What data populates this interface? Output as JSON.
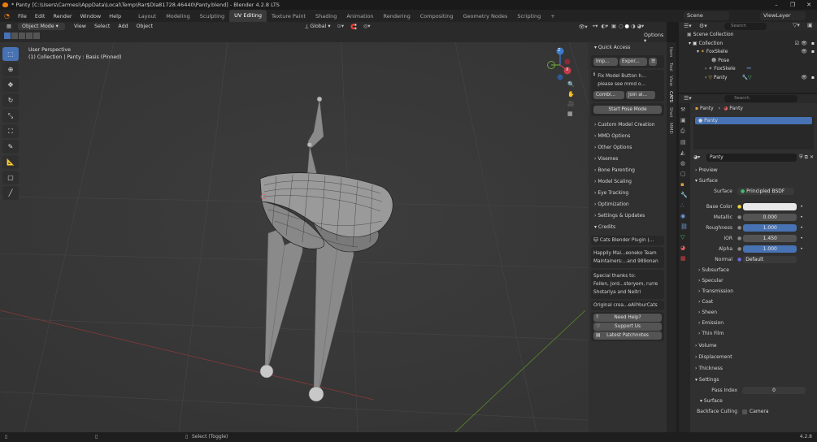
{
  "window": {
    "title": "* Panty [C:\\Users\\Carmesi\\AppData\\Local\\Temp\\Rar$DIa81728.46440\\Panty.blend] - Blender 4.2.8 LTS",
    "minimize": "–",
    "maximize": "❐",
    "close": "✕"
  },
  "menu": [
    "File",
    "Edit",
    "Render",
    "Window",
    "Help"
  ],
  "workspaces": [
    "Layout",
    "Modeling",
    "Sculpting",
    "UV Editing",
    "Texture Paint",
    "Shading",
    "Animation",
    "Rendering",
    "Compositing",
    "Geometry Nodes",
    "Scripting"
  ],
  "add_workspace": "+",
  "scene": "Scene",
  "viewlayer": "ViewLayer",
  "viewport_header": {
    "mode": "Object Mode",
    "menus": [
      "View",
      "Select",
      "Add",
      "Object"
    ],
    "orientation": "Global",
    "options": "Options"
  },
  "overlay_text": {
    "perspective": "User Perspective",
    "collection": "(1) Collection | Panty : Basis (Pinned)"
  },
  "gizmo": {
    "x": "X",
    "y": "Y",
    "z": "Z"
  },
  "npanel": {
    "quick_access": "Quick Access",
    "import": "Imp...",
    "export": "Expor...",
    "fix_model_text": "Fix Model Button h... please see mmd o...",
    "combine": "Combi...",
    "join": "Join al...",
    "start_pose": "Start Pose Mode",
    "sections": [
      "Custom Model Creation",
      "MMD Options",
      "Other Options",
      "Visemes",
      "Bone Parenting",
      "Model Scaling",
      "Eye Tracking",
      "Optimization",
      "Settings & Updates",
      "Credits"
    ],
    "credits": {
      "plugin": "Cats Blender Plugin (...",
      "line1": "Happily Mai...eoneko Team",
      "line2": "Maintainers:...and 989onan",
      "thanks": "Special thanks to:",
      "thanks1": "Feilen, Jord...steryem, rurre",
      "thanks2": "Shotariya and Neitri",
      "original": "Original crea...eAllYourCats",
      "help": "Need Help?",
      "support": "Support Us",
      "patchnotes": "Latest Patchnotes"
    },
    "tabs": [
      "Item",
      "Tool",
      "View",
      "CATS",
      "Shot",
      "MMD"
    ]
  },
  "outliner": {
    "search": "Search",
    "root": "Scene Collection",
    "items": [
      {
        "label": "Collection"
      },
      {
        "label": "FoxSkele"
      },
      {
        "label": "Pose"
      },
      {
        "label": "FoxSkele"
      },
      {
        "label": "Panty"
      }
    ]
  },
  "properties": {
    "search": "Search",
    "object": "Panty",
    "mesh": "Panty",
    "slot": "Panty",
    "material": "Panty",
    "preview": "Preview",
    "surface": "Surface",
    "surface_label": "Surface",
    "surface_value": "Principled BSDF",
    "rows": [
      {
        "label": "Base Color",
        "value": ""
      },
      {
        "label": "Metallic",
        "value": "0.000"
      },
      {
        "label": "Roughness",
        "value": "1.000"
      },
      {
        "label": "IOR",
        "value": "1.450"
      },
      {
        "label": "Alpha",
        "value": "1.000"
      },
      {
        "label": "Normal",
        "value": "Default"
      }
    ],
    "subsections": [
      "Subsurface",
      "Specular",
      "Transmission",
      "Coat",
      "Sheen",
      "Emission",
      "Thin Film"
    ],
    "sections2": [
      "Volume",
      "Displacement",
      "Thickness",
      "Settings"
    ],
    "pass_index_label": "Pass Index",
    "pass_index": "0",
    "surface2": "Surface",
    "backface": "Backface Culling",
    "camera": "Camera"
  },
  "status": {
    "select": "Select (Toggle)",
    "version": "4.2.8"
  },
  "colors": {
    "accent": "#4772b3",
    "active_tab": "#3a3a3a",
    "orange": "#e87d0d"
  }
}
